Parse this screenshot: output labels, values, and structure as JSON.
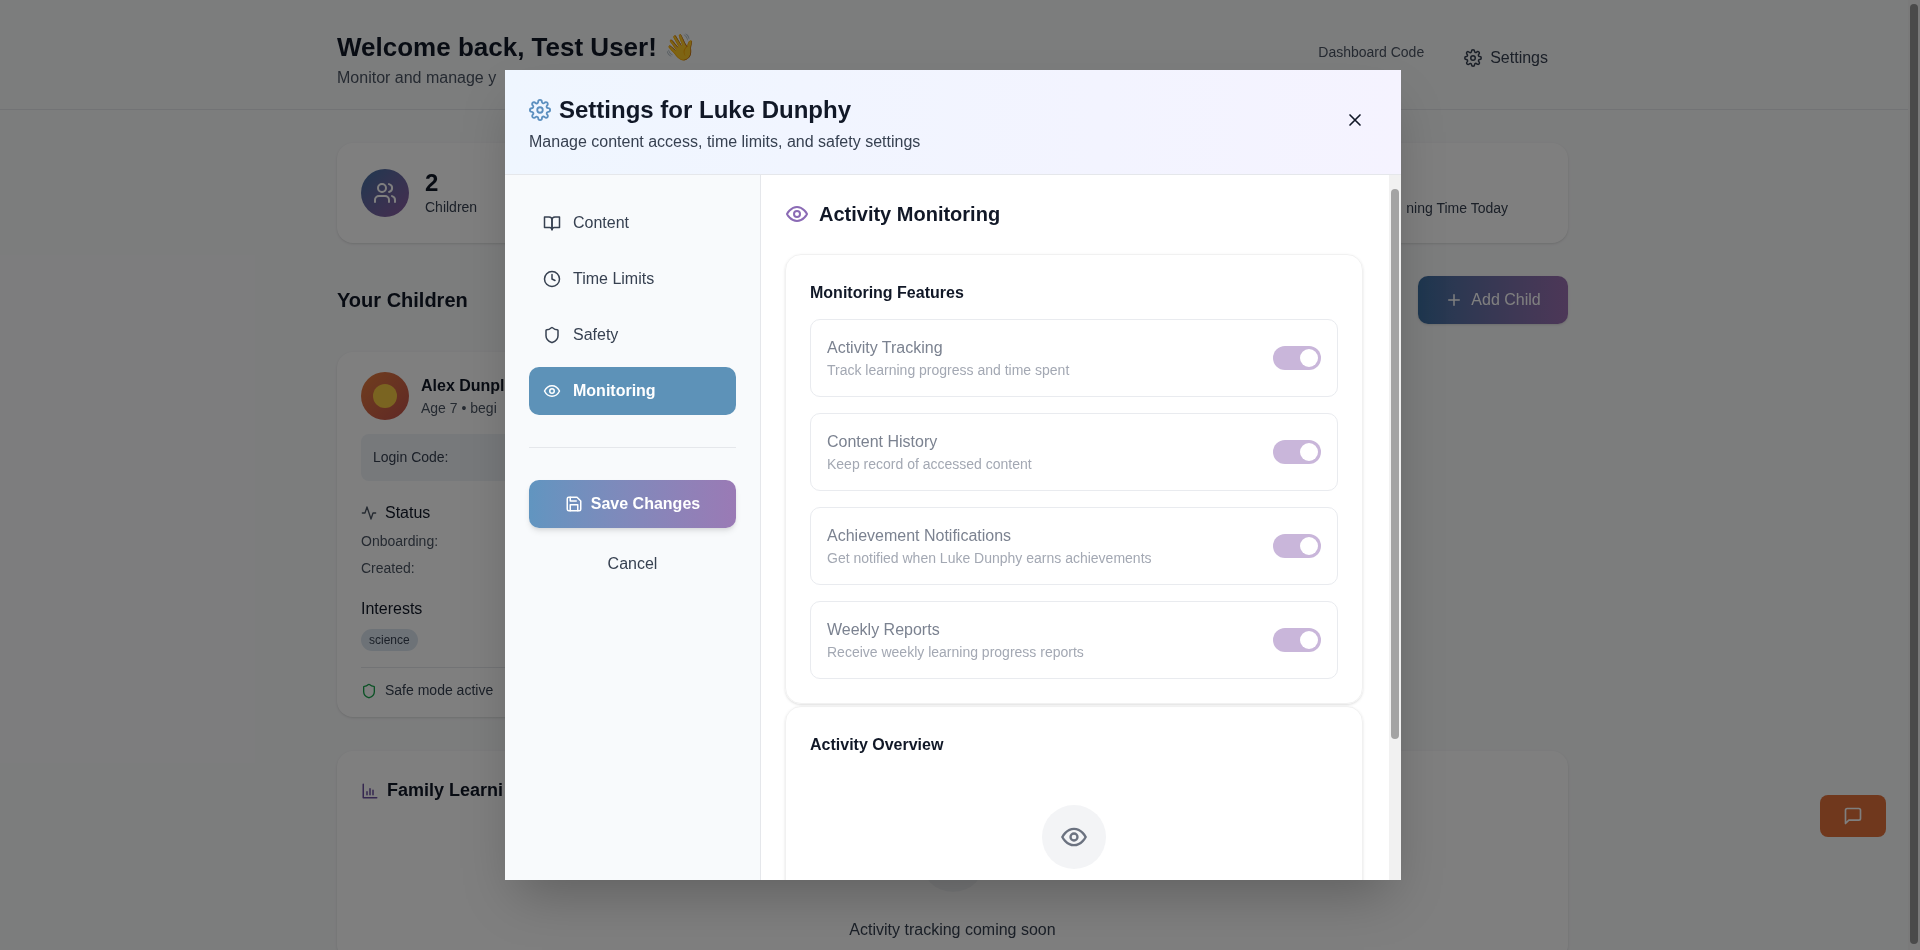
{
  "header": {
    "title": "Welcome back, Test User! 👋",
    "subtitle": "Monitor and manage y",
    "code_label": "Dashboard Code",
    "settings_button": "Settings"
  },
  "stats": [
    {
      "value": "2",
      "label": "Children"
    },
    {
      "label": "ning Time Today"
    }
  ],
  "children_section": {
    "title": "Your Children",
    "add_button": "Add Child"
  },
  "child_card": {
    "name": "Alex Dunpl",
    "meta": "Age 7 • begi",
    "login_label": "Login Code:",
    "status_title": "Status",
    "status_rows": [
      "Onboarding:",
      "Created:"
    ],
    "interests_title": "Interests",
    "interests": [
      "science"
    ],
    "safe_mode": "Safe mode active"
  },
  "family_card": {
    "title": "Family Learni",
    "empty_text": "Activity tracking coming soon"
  },
  "modal": {
    "title": "Settings for Luke Dunphy",
    "subtitle": "Manage content access, time limits, and safety settings",
    "tabs": [
      {
        "label": "Content",
        "selected": false
      },
      {
        "label": "Time Limits",
        "selected": false
      },
      {
        "label": "Safety",
        "selected": false
      },
      {
        "label": "Monitoring",
        "selected": true
      }
    ],
    "save_button": "Save Changes",
    "cancel_button": "Cancel",
    "section_title": "Activity Monitoring",
    "features_title": "Monitoring Features",
    "features": [
      {
        "title": "Activity Tracking",
        "description": "Track learning progress and time spent",
        "on": true,
        "disabled": true
      },
      {
        "title": "Content History",
        "description": "Keep record of accessed content",
        "on": true,
        "disabled": true
      },
      {
        "title": "Achievement Notifications",
        "description": "Get notified when Luke Dunphy earns achievements",
        "on": true,
        "disabled": true
      },
      {
        "title": "Weekly Reports",
        "description": "Receive weekly learning progress reports",
        "on": true,
        "disabled": true
      }
    ],
    "overview_title": "Activity Overview"
  }
}
